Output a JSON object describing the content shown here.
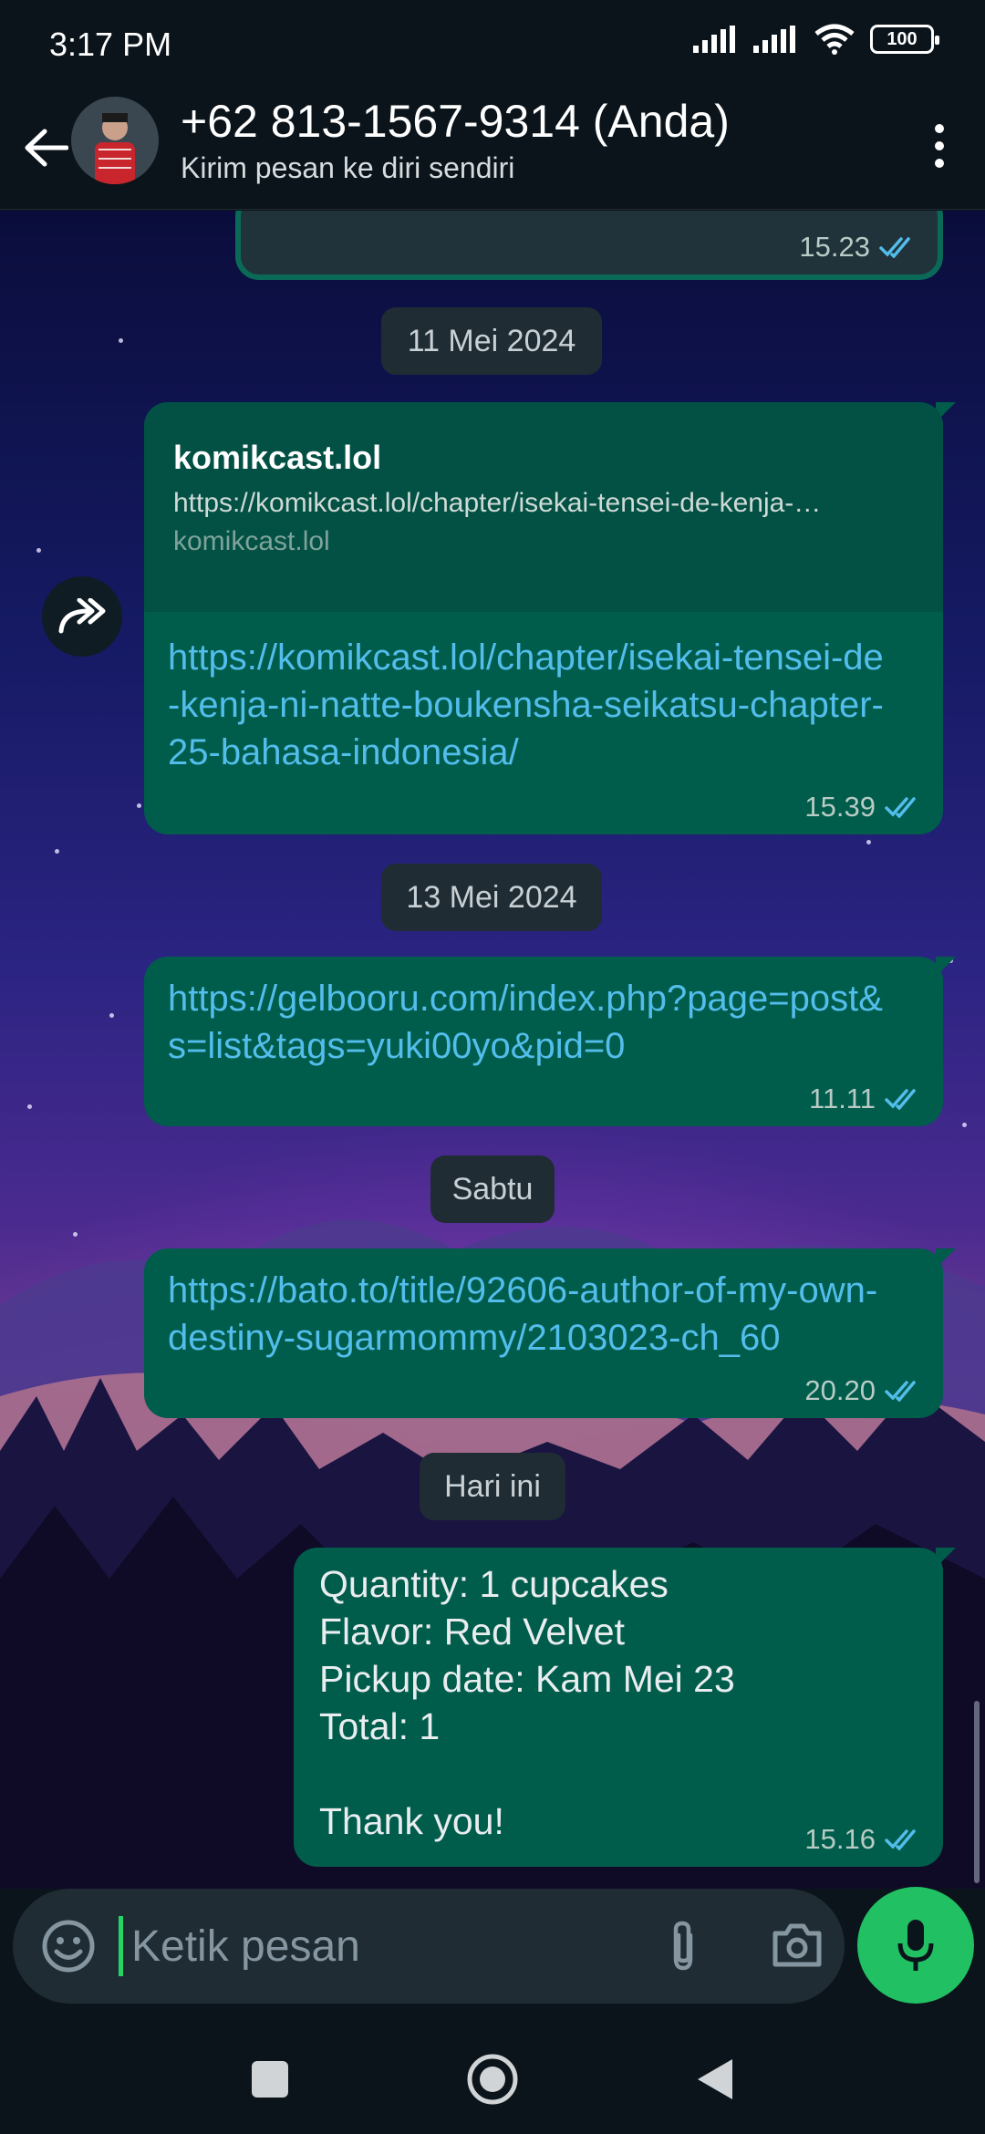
{
  "status": {
    "time": "3:17 PM",
    "battery": "100"
  },
  "header": {
    "contact_name": "+62 813-1567-9314 (Anda)",
    "subtitle": "Kirim pesan ke diri sendiri"
  },
  "messages": {
    "m0": {
      "time": "15.23"
    },
    "date1": "11 Mei 2024",
    "m1": {
      "preview_title": "komikcast.lol",
      "preview_url": "https://komikcast.lol/chapter/isekai-tensei-de-kenja-…",
      "preview_domain": "komikcast.lol",
      "text": "https://komikcast.lol/chapter/isekai-tensei-de-kenja-ni-natte-boukensha-seikatsu-chapter-25-bahasa-indonesia/",
      "time": "15.39"
    },
    "date2": "13 Mei 2024",
    "m2": {
      "text": "https://gelbooru.com/index.php?page=post&s=list&tags=yuki00yo&pid=0",
      "time": "11.11"
    },
    "date3": "Sabtu",
    "m3": {
      "text": "https://bato.to/title/92606-author-of-my-own-destiny-sugarmommy/2103023-ch_60",
      "time": "20.20"
    },
    "date4": "Hari ini",
    "m4": {
      "text": "Quantity: 1 cupcakes\nFlavor: Red Velvet\nPickup date: Kam Mei 23\nTotal: 1\n\nThank you!",
      "time": "15.16"
    }
  },
  "composer": {
    "placeholder": "Ketik pesan"
  },
  "icons": {
    "back": "arrow-left-icon",
    "menu": "more-vert-icon",
    "forward": "forward-icon",
    "emoji": "emoji-icon",
    "attach": "paperclip-icon",
    "camera": "camera-icon",
    "mic": "mic-icon",
    "read_receipt": "double-check-icon"
  },
  "colors": {
    "bubble": "#005c4b",
    "link": "#53bdeb",
    "read_tick": "#53bdeb",
    "mic": "#21c063"
  }
}
